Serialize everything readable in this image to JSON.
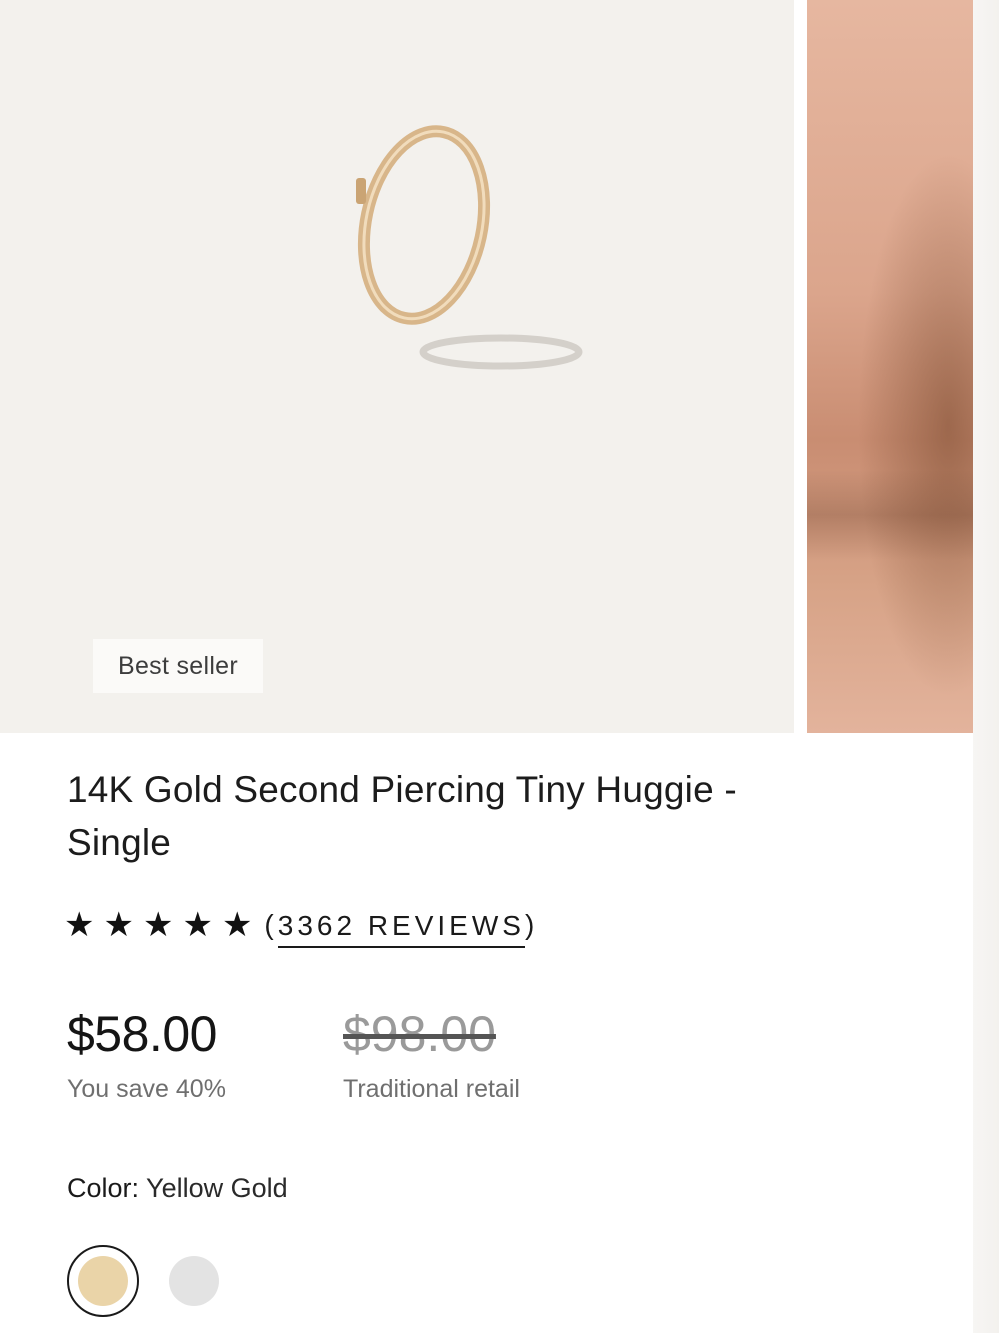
{
  "gallery": {
    "badge_text": "Best seller",
    "main_image_icon": "hoop-earring-image",
    "next_image_icon": "ear-skin-closeup-image"
  },
  "product": {
    "title": "14K Gold Second Piercing Tiny Huggie - Single",
    "rating_stars": 5,
    "reviews_open": "(",
    "reviews_label": "3362 REVIEWS",
    "reviews_close": ")"
  },
  "pricing": {
    "current_price": "$58.00",
    "savings_text": "You save 40%",
    "original_price": "$98.00",
    "original_label": "Traditional retail"
  },
  "color": {
    "label": "Color:",
    "selected": "Yellow Gold",
    "swatches": [
      {
        "name": "Yellow Gold",
        "hex": "#ead4a8",
        "selected": true
      },
      {
        "name": "Silver",
        "hex": "#e3e3e3",
        "selected": false
      }
    ]
  },
  "colors": {
    "image_bg": "#f3f1ed",
    "text": "#1c1c1c",
    "muted": "#6f6f6f"
  }
}
